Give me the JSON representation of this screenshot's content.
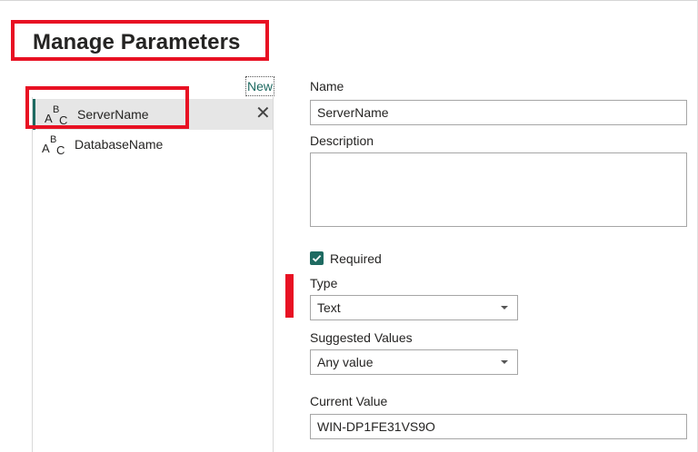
{
  "title": "Manage Parameters",
  "list": {
    "new_label": "New",
    "items": [
      {
        "label": "ServerName",
        "icon": "abc-type-icon",
        "selected": true
      },
      {
        "label": "DatabaseName",
        "icon": "abc-type-icon",
        "selected": false
      }
    ],
    "delete_icon": "close-icon",
    "delete_glyph": "✕"
  },
  "form": {
    "name_label": "Name",
    "name_value": "ServerName",
    "description_label": "Description",
    "description_value": "",
    "required_label": "Required",
    "required_checked": true,
    "type_label": "Type",
    "type_value": "Text",
    "suggested_label": "Suggested Values",
    "suggested_value": "Any value",
    "current_label": "Current Value",
    "current_value": "WIN-DP1FE31VS9O"
  },
  "colors": {
    "accent": "#1e6a61",
    "highlight": "#e81123",
    "selected_bg": "#e6e6e6"
  }
}
